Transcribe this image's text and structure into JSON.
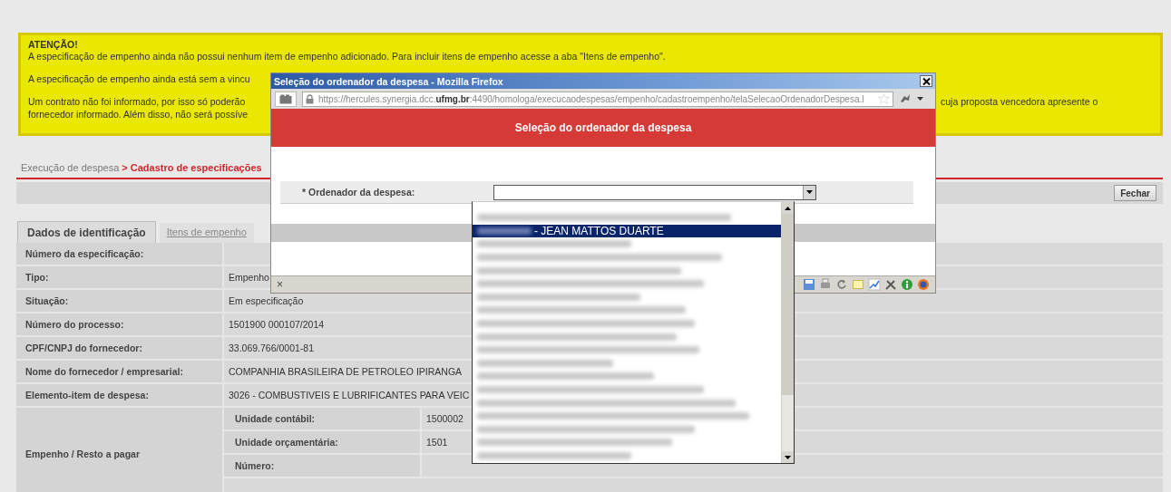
{
  "alert": {
    "title": "ATENÇÃO!",
    "paragraphs": [
      [
        {
          "left": "A especificação de empenho ainda não possui nenhum item de empenho adicionado. Para incluir itens de empenho acesse a aba \"Itens de empenho\"."
        }
      ],
      [
        {
          "left": "A especificação de empenho ainda está sem a vincu"
        }
      ],
      [
        {
          "left": "Um contrato não foi informado, por isso só poderão",
          "right": "cuja proposta vencedora apresente o"
        },
        {
          "left": "fornecedor informado. Além disso, não será possíve"
        }
      ]
    ]
  },
  "breadcrumb": {
    "parent": "Execução de despesa",
    "current": "> Cadastro de especificações"
  },
  "toolbar": {
    "buttons": [
      "Fechar"
    ]
  },
  "tabs": [
    {
      "label": "Dados de identificação",
      "selected": true
    },
    {
      "label": "Itens de empenho",
      "selected": false
    }
  ],
  "details": {
    "rows": [
      {
        "label": "Número da especificação:"
      },
      {
        "label": "Tipo:",
        "value": "Empenho"
      },
      {
        "label": "Situação:",
        "value": "Em especificação"
      },
      {
        "label": "Número do processo:",
        "value": "1501900 000107/2014"
      },
      {
        "label": "CPF/CNPJ do fornecedor:",
        "value": "33.069.766/0001-81"
      },
      {
        "label": "Nome do fornecedor / empresarial:",
        "value": "COMPANHIA BRASILEIRA DE PETROLEO IPIRANGA"
      },
      {
        "label": "Elemento-item de despesa:",
        "value": "3026 - COMBUSTIVEIS E LUBRIFICANTES PARA VEIC"
      },
      {
        "label": "Empenho / Resto a pagar",
        "kind": "group",
        "children": [
          {
            "label": "Unidade contábil:",
            "value": "1500002"
          },
          {
            "label": "Unidade orçamentária:",
            "value": "1501"
          },
          {
            "label": "Número:"
          }
        ]
      }
    ]
  },
  "popup": {
    "window_title": "Seleção do ordenador da despesa - Mozilla Firefox",
    "url": "https://hercules.synergia.dcc.**ufmg.br**:4490/homologa/execucaodespesas/empenho/cadastroempenho/telaSelecaoOrdenadorDespesa.l",
    "heading": "Seleção do ordenador da despesa",
    "field": {
      "label": "* Ordenador da despesa:",
      "expanded": true,
      "options": [
        {
          "kind": "redacted",
          "selected": false
        },
        {
          "kind": "named",
          "label": "- JEAN MATTOS DUARTE",
          "selected": true
        },
        {
          "kind": "redacted",
          "selected": false
        },
        {
          "kind": "redacted",
          "selected": false
        },
        {
          "kind": "redacted",
          "selected": false
        },
        {
          "kind": "redacted",
          "selected": false
        },
        {
          "kind": "redacted",
          "selected": false
        },
        {
          "kind": "redacted",
          "selected": false
        },
        {
          "kind": "redacted",
          "selected": false
        },
        {
          "kind": "redacted",
          "selected": false
        },
        {
          "kind": "redacted",
          "selected": false
        },
        {
          "kind": "redacted",
          "selected": false
        },
        {
          "kind": "redacted",
          "selected": false
        },
        {
          "kind": "redacted",
          "selected": false
        },
        {
          "kind": "redacted",
          "selected": false
        },
        {
          "kind": "redacted",
          "selected": false
        },
        {
          "kind": "redacted",
          "selected": false
        },
        {
          "kind": "redacted",
          "selected": false
        },
        {
          "kind": "redacted",
          "selected": false
        }
      ]
    },
    "status_close": "×"
  }
}
